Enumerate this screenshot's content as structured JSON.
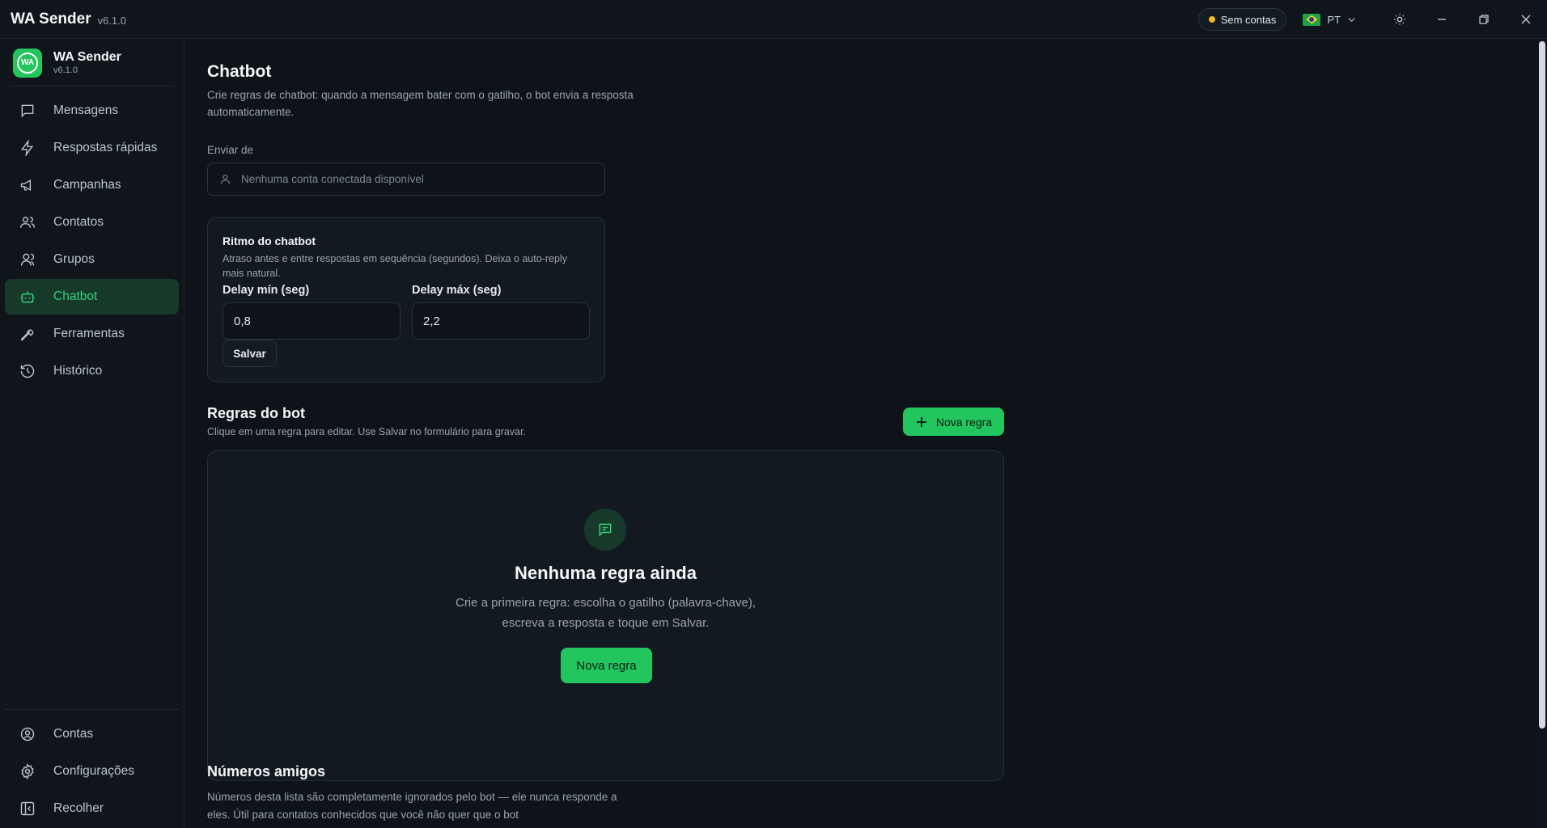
{
  "titlebar": {
    "title": "WA Sender",
    "version": "v6.1.0",
    "status": "Sem contas",
    "language": "PT",
    "colors": {
      "status_dot": "#f5b921"
    }
  },
  "sidebar": {
    "brand_name": "WA Sender",
    "brand_version": "v6.1.0",
    "logo_text": "WA",
    "items": [
      {
        "label": "Mensagens",
        "icon": "message-icon"
      },
      {
        "label": "Respostas rápidas",
        "icon": "lightning-icon"
      },
      {
        "label": "Campanhas",
        "icon": "megaphone-icon"
      },
      {
        "label": "Contatos",
        "icon": "users-icon"
      },
      {
        "label": "Grupos",
        "icon": "group-icon"
      },
      {
        "label": "Chatbot",
        "icon": "bot-icon",
        "active": true
      },
      {
        "label": "Ferramentas",
        "icon": "wrench-icon"
      },
      {
        "label": "Histórico",
        "icon": "history-icon"
      }
    ],
    "bottom_items": [
      {
        "label": "Contas",
        "icon": "account-icon"
      },
      {
        "label": "Configurações",
        "icon": "settings-icon"
      },
      {
        "label": "Recolher",
        "icon": "collapse-icon"
      }
    ],
    "colors": {
      "accent": "#34d07a",
      "active_bg": "#17392a"
    }
  },
  "main": {
    "title": "Chatbot",
    "subtitle": "Crie regras de chatbot: quando a mensagem bater com o gatilho, o bot envia a resposta automaticamente.",
    "sender": {
      "label": "Enviar de",
      "placeholder": "Nenhuma conta conectada disponível"
    },
    "rhythm": {
      "title": "Ritmo do chatbot",
      "subtitle": "Atraso antes e entre respostas em sequência (segundos). Deixa o auto-reply mais natural.",
      "delay_min_label": "Delay mín (seg)",
      "delay_min_value": "0,8",
      "delay_max_label": "Delay máx (seg)",
      "delay_max_value": "2,2",
      "save_label": "Salvar"
    },
    "rules": {
      "title": "Regras do bot",
      "subtitle": "Clique em uma regra para editar. Use Salvar no formulário para gravar.",
      "new_rule_label": "Nova regra",
      "empty_title": "Nenhuma regra ainda",
      "empty_text_1": "Crie a primeira regra: escolha o gatilho (palavra-chave),",
      "empty_text_2": "escreva a resposta e toque em Salvar.",
      "empty_button": "Nova regra"
    },
    "friends": {
      "title": "Números amigos",
      "text": "Números desta lista são completamente ignorados pelo bot — ele nunca responde a eles. Útil para contatos conhecidos que você não quer que o bot"
    },
    "colors": {
      "primary": "#22c55e"
    }
  }
}
